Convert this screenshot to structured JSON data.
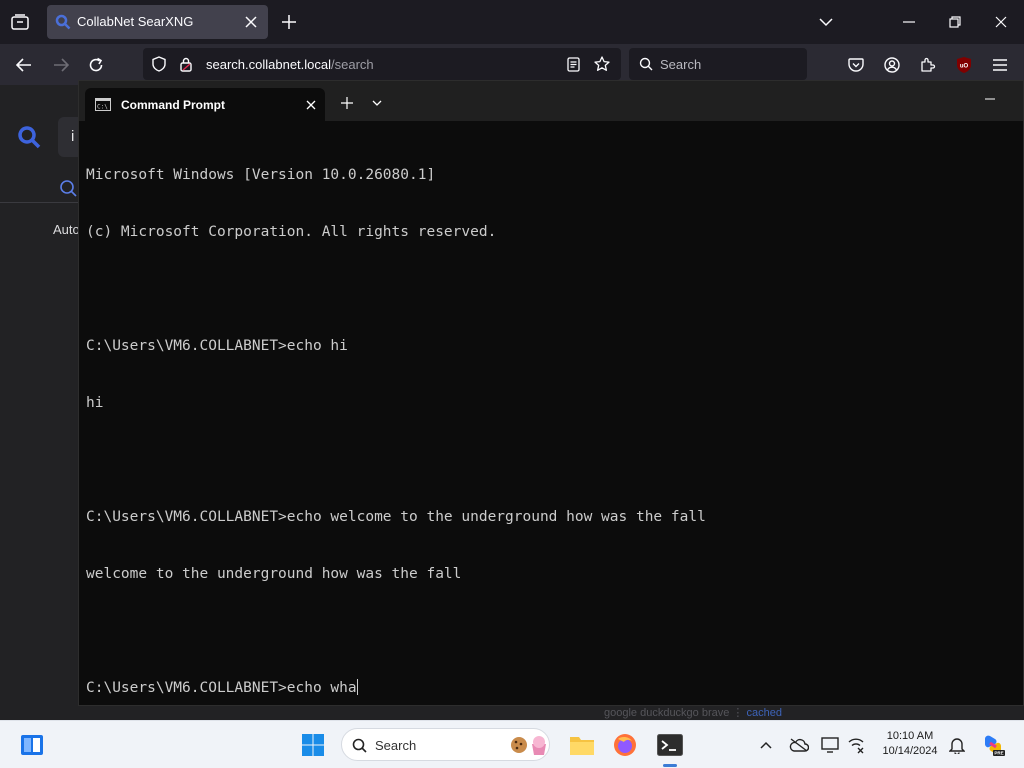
{
  "browser": {
    "tab": {
      "title": "CollabNet SearXNG"
    },
    "urlbar": {
      "host": "search.collabnet.local",
      "path": "/search"
    },
    "searchbar": {
      "placeholder": "Search"
    },
    "icons": [
      "tab-list-icon",
      "searxng-favicon",
      "tab-close-icon",
      "new-tab-icon",
      "list-all-tabs-icon",
      "minimize-icon",
      "restore-icon",
      "close-icon",
      "back-icon",
      "forward-icon",
      "reload-icon",
      "shield-icon",
      "lock-icon",
      "reader-view-icon",
      "bookmark-star-icon",
      "search-icon",
      "pocket-icon",
      "account-icon",
      "extensions-icon",
      "ublock-icon",
      "menu-icon"
    ]
  },
  "page": {
    "partial_input": "i",
    "partial_label": "Auto",
    "footer": {
      "engines": "google  duckduckgo  brave  ⋮",
      "cached": "cached"
    }
  },
  "terminal": {
    "tab_title": "Command Prompt",
    "lines": [
      "Microsoft Windows [Version 10.0.26080.1]",
      "(c) Microsoft Corporation. All rights reserved.",
      "",
      "C:\\Users\\VM6.COLLABNET>echo hi",
      "hi",
      "",
      "C:\\Users\\VM6.COLLABNET>echo welcome to the underground how was the fall",
      "welcome to the underground how was the fall",
      "",
      "C:\\Users\\VM6.COLLABNET>echo wha"
    ]
  },
  "taskbar": {
    "search_label": "Search",
    "time": "10:10 AM",
    "date": "10/14/2024",
    "pinned": [
      "start-icon",
      "search-icon",
      "file-explorer-icon",
      "firefox-icon",
      "terminal-icon"
    ],
    "tray": [
      "show-hidden-icons-chevron",
      "onedrive-icon",
      "display-icon",
      "network-icon",
      "notification-bell-icon",
      "copilot-icon"
    ]
  },
  "colors": {
    "accent": "#3a7bd5",
    "page_link": "#3d63b8",
    "terminal_bg": "#0c0c0c",
    "terminal_fg": "#cccccc"
  }
}
